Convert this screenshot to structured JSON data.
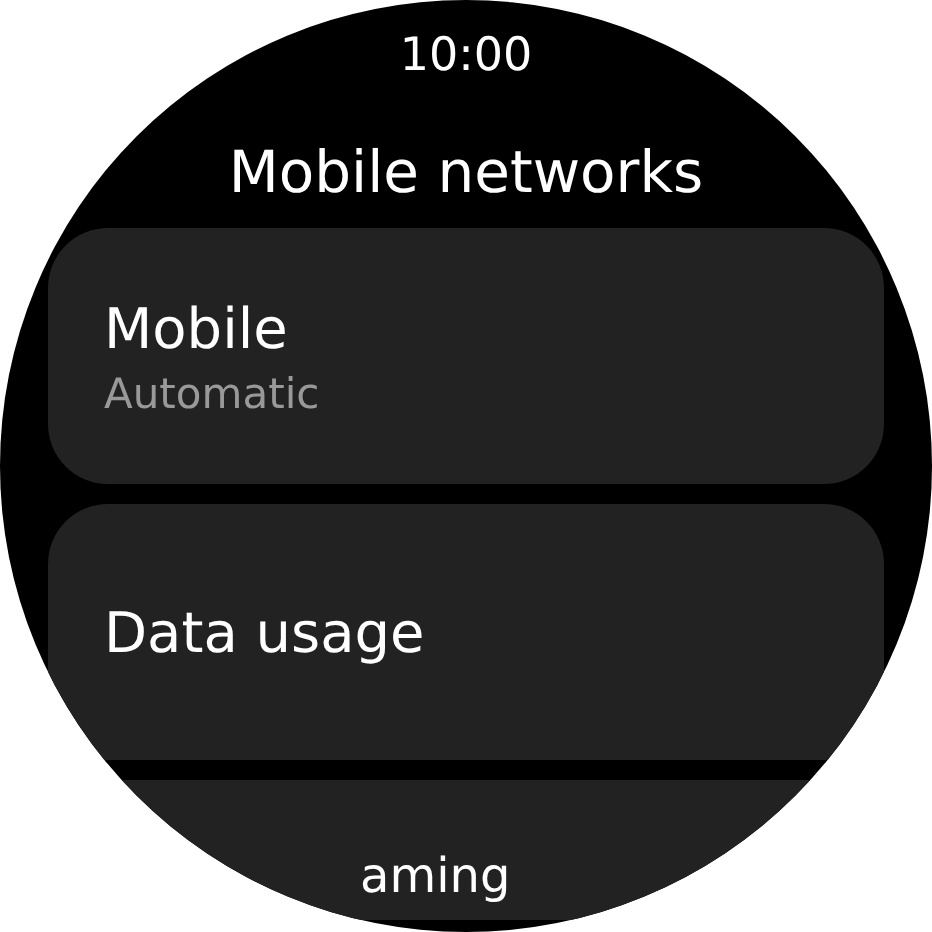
{
  "status_bar": {
    "time": "10:00"
  },
  "title": "Mobile networks",
  "items": [
    {
      "label": "Mobile",
      "summary": "Automatic"
    },
    {
      "label": "Data usage"
    },
    {
      "label": "aming"
    }
  ]
}
